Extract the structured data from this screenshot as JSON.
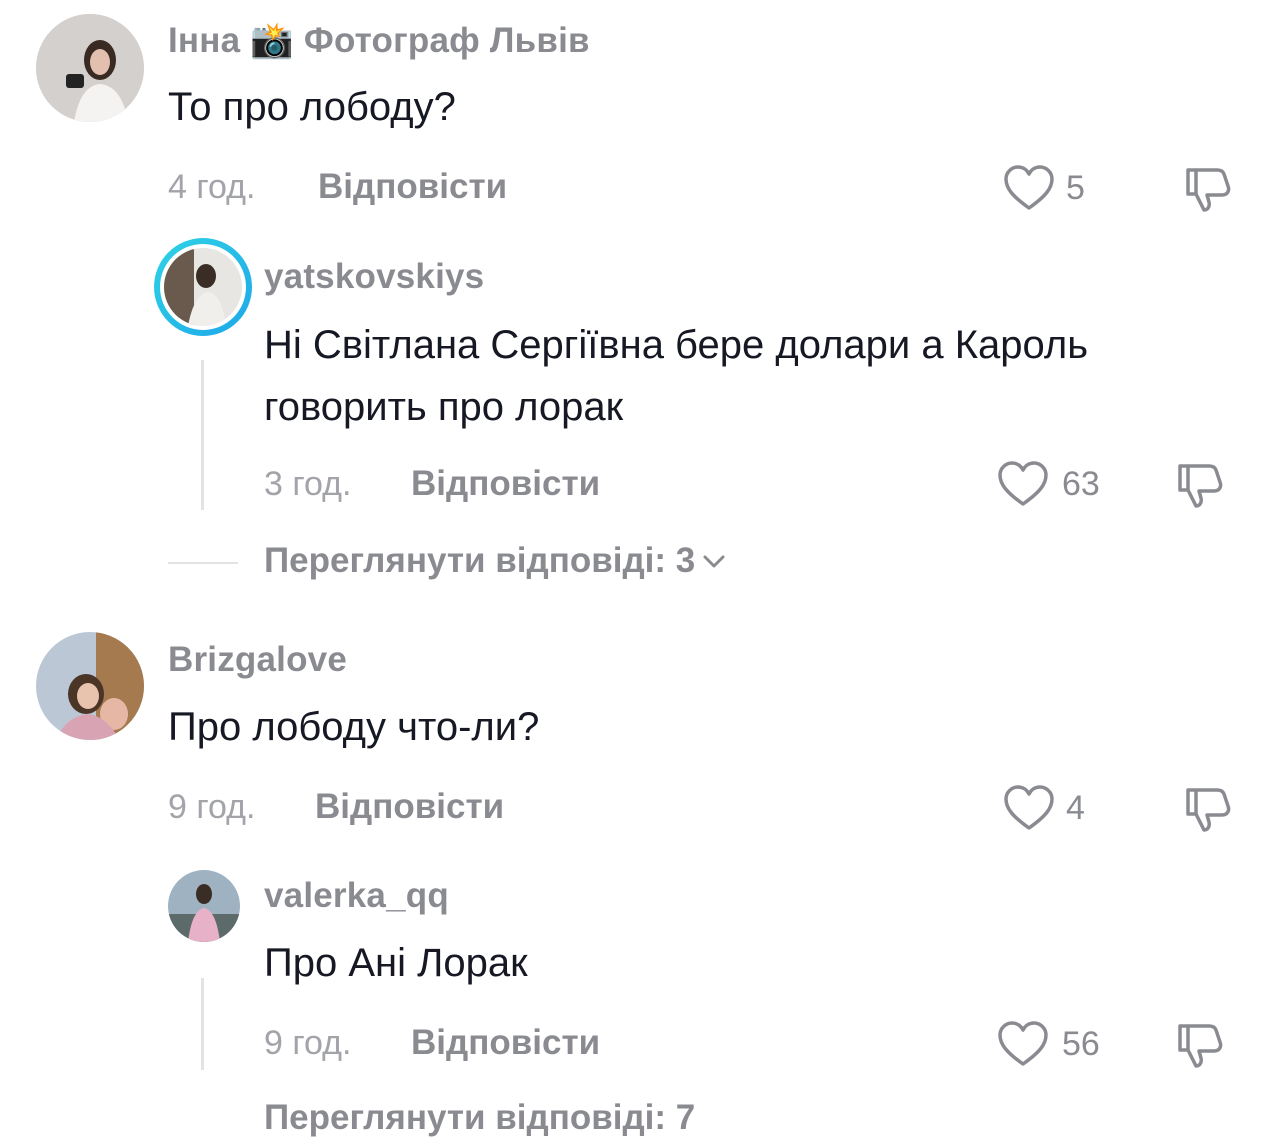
{
  "comments": [
    {
      "username": "Інна 📸 Фотограф Львів",
      "text": "То про лободу?",
      "time": "4 год.",
      "reply_label": "Відповісти",
      "likes": "5",
      "replies": [
        {
          "username": "yatskovskiys",
          "text": "Ні Світлана Сергіївна бере долари а Кароль говорить про лорак",
          "time": "3 год.",
          "reply_label": "Відповісти",
          "likes": "63"
        }
      ],
      "view_replies": "Переглянути відповіді: 3"
    },
    {
      "username": "Brizgalove",
      "text": "Про лободу что-ли?",
      "time": "9 год.",
      "reply_label": "Відповісти",
      "likes": "4",
      "replies": [
        {
          "username": "valerka_qq",
          "text": "Про Ані Лорак",
          "time": "9 год.",
          "reply_label": "Відповісти",
          "likes": "56"
        }
      ],
      "view_replies": "Переглянути відповіді: 7"
    }
  ],
  "icons": {
    "like": "heart-icon",
    "dislike": "dislike-icon",
    "expand": "chevron-down-icon"
  },
  "colors": {
    "story_ring_start": "#2fd3e6",
    "story_ring_end": "#1ea7e8",
    "muted_text": "#8a8b91"
  }
}
